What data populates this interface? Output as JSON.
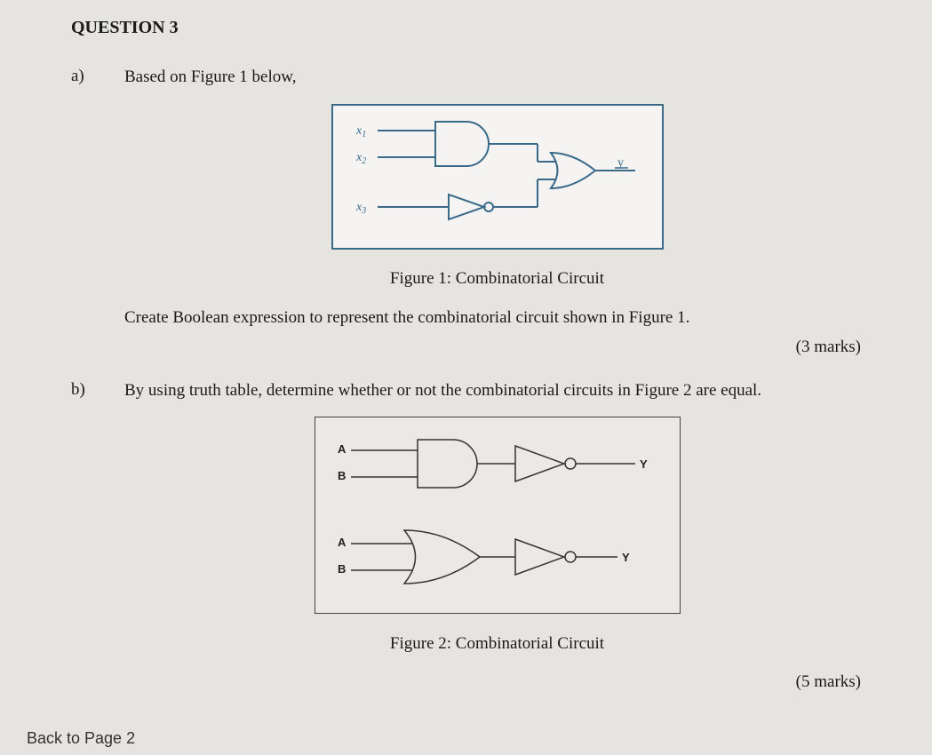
{
  "question": {
    "title": "QUESTION 3",
    "parts": {
      "a": {
        "label": "a)",
        "intro": "Based on Figure 1 below,",
        "figure": {
          "caption": "Figure 1: Combinatorial Circuit",
          "inputs": [
            "x1",
            "x2",
            "x3"
          ],
          "output": "y",
          "gates": [
            "AND",
            "NOT",
            "OR"
          ]
        },
        "instruction": "Create Boolean expression to represent the combinatorial circuit shown in Figure 1.",
        "marks": "(3 marks)"
      },
      "b": {
        "label": "b)",
        "intro": "By using truth table, determine whether or not the combinatorial circuits in Figure 2 are equal.",
        "figure": {
          "caption": "Figure 2: Combinatorial Circuit",
          "circuit1": {
            "inputs": [
              "A",
              "B"
            ],
            "output": "Y",
            "gates": [
              "AND",
              "NOT"
            ]
          },
          "circuit2": {
            "inputs": [
              "A",
              "B"
            ],
            "output": "Y",
            "gates": [
              "OR",
              "NOT"
            ]
          }
        },
        "marks": "(5 marks)"
      }
    }
  },
  "nav": {
    "back": "Back to Page 2"
  },
  "labels": {
    "x1": "x",
    "x1sub": "1",
    "x2": "x",
    "x2sub": "2",
    "x3": "x",
    "x3sub": "3",
    "y": "y",
    "A": "A",
    "B": "B",
    "Y": "Y"
  }
}
